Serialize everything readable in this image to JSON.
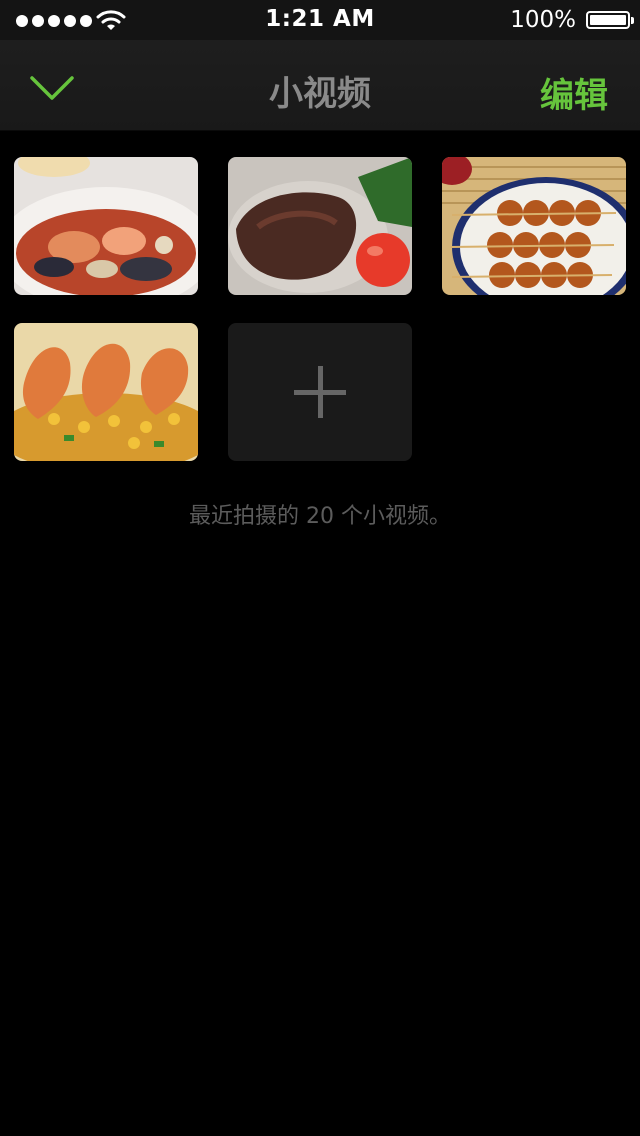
{
  "status_bar": {
    "time": "1:21 AM",
    "battery_percent": "100%",
    "icons": [
      "signal-dots-icon",
      "wifi-icon",
      "battery-icon"
    ]
  },
  "nav": {
    "back_icon": "chevron-down-icon",
    "title": "小视频",
    "edit_label": "编辑",
    "accent_color": "#66c43c"
  },
  "videos": {
    "items": [
      {
        "subject": "seafood-stew"
      },
      {
        "subject": "grilled-steak"
      },
      {
        "subject": "meatball-skewers"
      },
      {
        "subject": "shrimp-corn"
      }
    ],
    "add_icon": "plus-icon"
  },
  "caption": "最近拍摄的 20 个小视频。"
}
